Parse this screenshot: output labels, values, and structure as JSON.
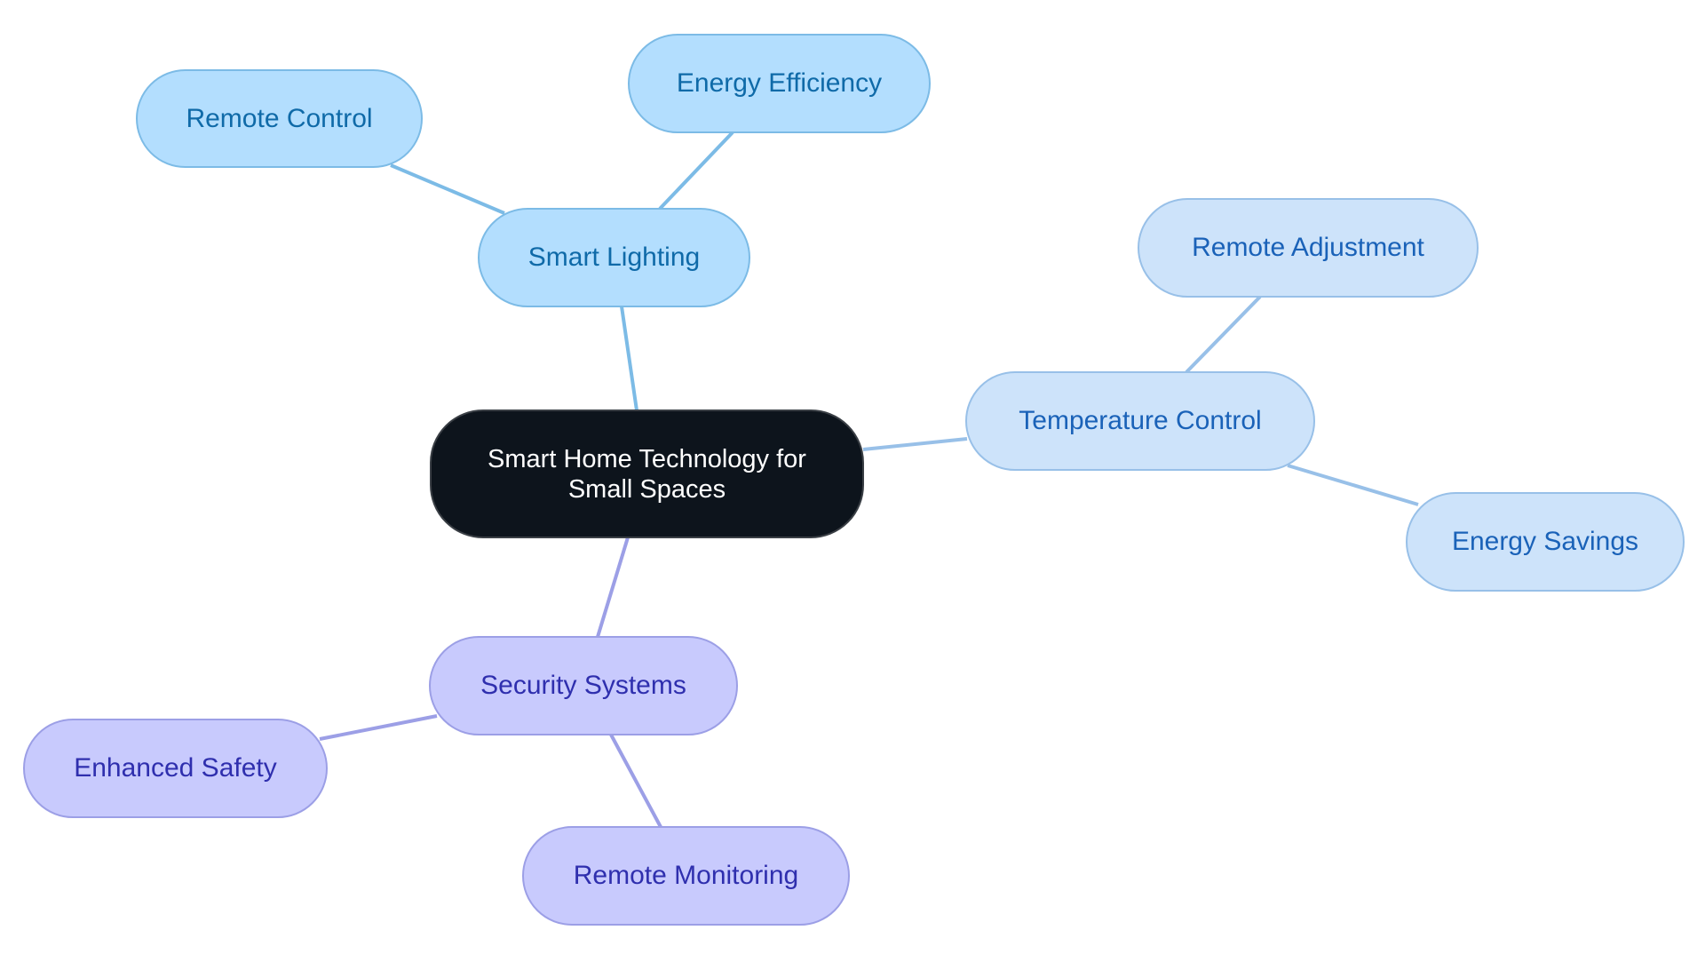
{
  "diagram": {
    "type": "mind-map",
    "root": {
      "id": "root",
      "label_line1": "Smart Home Technology for",
      "label_line2": "Small Spaces"
    },
    "branches": [
      {
        "id": "lighting",
        "label": "Smart Lighting",
        "color_fill": "#b3defe",
        "color_edge": "#7cbbe6",
        "color_text": "#0f6aa8",
        "children": [
          {
            "id": "lighting-c1",
            "label": "Remote Control"
          },
          {
            "id": "lighting-c2",
            "label": "Energy Efficiency"
          }
        ]
      },
      {
        "id": "temp",
        "label": "Temperature Control",
        "color_fill": "#cde3fa",
        "color_edge": "#98c0e8",
        "color_text": "#1a62b8",
        "children": [
          {
            "id": "temp-c1",
            "label": "Remote Adjustment"
          },
          {
            "id": "temp-c2",
            "label": "Energy Savings"
          }
        ]
      },
      {
        "id": "security",
        "label": "Security Systems",
        "color_fill": "#c8cafd",
        "color_edge": "#9c9fe6",
        "color_text": "#2f2fae",
        "children": [
          {
            "id": "security-c1",
            "label": "Enhanced Safety"
          },
          {
            "id": "security-c2",
            "label": "Remote Monitoring"
          }
        ]
      }
    ],
    "root_color": "#0d141c"
  }
}
